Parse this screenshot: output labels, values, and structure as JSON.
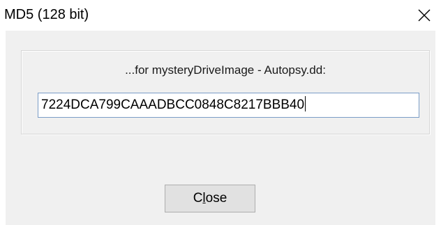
{
  "window": {
    "title": "MD5 (128 bit)",
    "close_glyph": "×"
  },
  "group": {
    "caption": "...for mysteryDriveImage - Autopsy.dd:",
    "hash_value": "7224DCA799CAAADBCC0848C8217BBB40"
  },
  "buttons": {
    "close_label_pre": "C",
    "close_label_mnemonic": "l",
    "close_label_post": "ose"
  },
  "colors": {
    "dialog_background": "#f0f0f0",
    "field_border": "#7a9cc6",
    "button_face": "#e1e1e1"
  },
  "icons": {
    "title_close": "close-icon"
  }
}
